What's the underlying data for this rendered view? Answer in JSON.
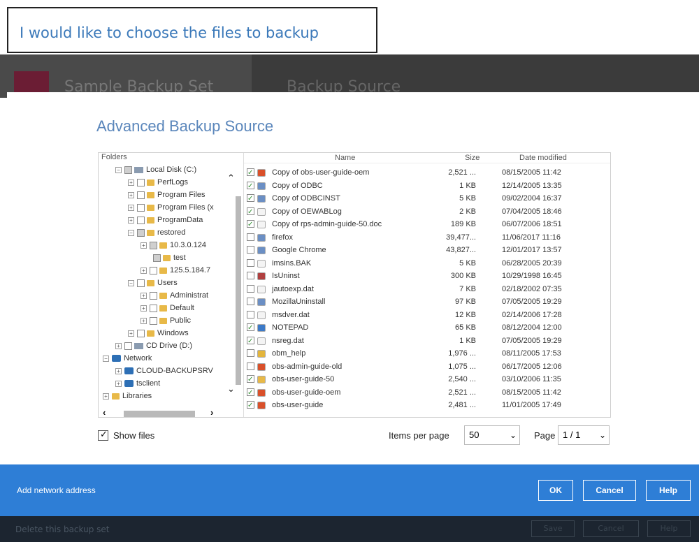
{
  "callout": {
    "text": "I would like to choose the files to backup"
  },
  "background": {
    "set_title": "Sample Backup Set",
    "section_title": "Backup Source"
  },
  "dialog": {
    "title": "Advanced Backup Source",
    "folders_header": "Folders",
    "tree": [
      {
        "label": "Local Disk (C:)",
        "icon": "drive-icon"
      },
      {
        "label": "PerfLogs",
        "icon": "folder-icon"
      },
      {
        "label": "Program Files",
        "icon": "folder-icon"
      },
      {
        "label": "Program Files (x",
        "icon": "folder-icon"
      },
      {
        "label": "ProgramData",
        "icon": "folder-icon"
      },
      {
        "label": "restored",
        "icon": "folder-icon"
      },
      {
        "label": "10.3.0.124",
        "icon": "folder-icon"
      },
      {
        "label": "test",
        "icon": "folder-icon"
      },
      {
        "label": "125.5.184.7",
        "icon": "folder-icon"
      },
      {
        "label": "Users",
        "icon": "folder-icon"
      },
      {
        "label": "Administrat",
        "icon": "folder-icon"
      },
      {
        "label": "Default",
        "icon": "folder-icon"
      },
      {
        "label": "Public",
        "icon": "folder-icon"
      },
      {
        "label": "Windows",
        "icon": "folder-icon"
      },
      {
        "label": "CD Drive (D:)",
        "icon": "cd-drive-icon"
      },
      {
        "label": "Network",
        "icon": "network-icon"
      },
      {
        "label": "CLOUD-BACKUPSRV",
        "icon": "computer-icon"
      },
      {
        "label": "tsclient",
        "icon": "computer-icon"
      },
      {
        "label": "Libraries",
        "icon": "library-icon"
      }
    ],
    "columns": {
      "name": "Name",
      "size": "Size",
      "date": "Date modified"
    },
    "files": [
      {
        "name": "Copy of obs-user-guide-oem",
        "size": "2,521 ...",
        "date": "08/15/2005 11:42",
        "checked": true,
        "icon": "chrome-doc-icon"
      },
      {
        "name": "Copy of ODBC",
        "size": "1 KB",
        "date": "12/14/2005 13:35",
        "checked": true,
        "icon": "config-icon"
      },
      {
        "name": "Copy of ODBCINST",
        "size": "5 KB",
        "date": "09/02/2004 16:37",
        "checked": true,
        "icon": "config-icon"
      },
      {
        "name": "Copy of OEWABLog",
        "size": "2 KB",
        "date": "07/04/2005 18:46",
        "checked": true,
        "icon": "text-file-icon"
      },
      {
        "name": "Copy of rps-admin-guide-50.doc",
        "size": "189 KB",
        "date": "06/07/2006 18:51",
        "checked": true,
        "icon": "text-file-icon"
      },
      {
        "name": "firefox",
        "size": "39,477...",
        "date": "11/06/2017 11:16",
        "checked": false,
        "icon": "shortcut-icon"
      },
      {
        "name": "Google Chrome",
        "size": "43,827...",
        "date": "12/01/2017 13:57",
        "checked": false,
        "icon": "shortcut-icon"
      },
      {
        "name": "imsins.BAK",
        "size": "5 KB",
        "date": "06/28/2005 20:39",
        "checked": false,
        "icon": "text-file-icon"
      },
      {
        "name": "IsUninst",
        "size": "300 KB",
        "date": "10/29/1998 16:45",
        "checked": false,
        "icon": "installer-icon"
      },
      {
        "name": "jautoexp.dat",
        "size": "7 KB",
        "date": "02/18/2002 07:35",
        "checked": false,
        "icon": "text-file-icon"
      },
      {
        "name": "MozillaUninstall",
        "size": "97 KB",
        "date": "07/05/2005 19:29",
        "checked": false,
        "icon": "shortcut-icon"
      },
      {
        "name": "msdver.dat",
        "size": "12 KB",
        "date": "02/14/2006 17:28",
        "checked": false,
        "icon": "text-file-icon"
      },
      {
        "name": "NOTEPAD",
        "size": "65 KB",
        "date": "08/12/2004 12:00",
        "checked": true,
        "icon": "notepad-icon"
      },
      {
        "name": "nsreg.dat",
        "size": "1 KB",
        "date": "07/05/2005 19:29",
        "checked": true,
        "icon": "text-file-icon"
      },
      {
        "name": "obm_help",
        "size": "1,976 ...",
        "date": "08/11/2005 17:53",
        "checked": false,
        "icon": "help-file-icon"
      },
      {
        "name": "obs-admin-guide-old",
        "size": "1,075 ...",
        "date": "06/17/2005 12:06",
        "checked": false,
        "icon": "chrome-doc-icon"
      },
      {
        "name": "obs-user-guide-50",
        "size": "2,540 ...",
        "date": "03/10/2006 11:35",
        "checked": true,
        "icon": "folder-icon"
      },
      {
        "name": "obs-user-guide-oem",
        "size": "2,521 ...",
        "date": "08/15/2005 11:42",
        "checked": true,
        "icon": "chrome-doc-icon"
      },
      {
        "name": "obs-user-guide",
        "size": "2,481 ...",
        "date": "11/01/2005 17:49",
        "checked": true,
        "icon": "chrome-doc-icon"
      }
    ],
    "show_files": "Show files",
    "items_per_page_label": "Items per page",
    "items_per_page_value": "50",
    "page_label": "Page",
    "page_value": "1 / 1"
  },
  "action_bar": {
    "add_network": "Add network address",
    "ok": "OK",
    "cancel": "Cancel",
    "help": "Help"
  },
  "footer": {
    "delete": "Delete this backup set",
    "save": "Save",
    "cancel": "Cancel",
    "help": "Help"
  }
}
